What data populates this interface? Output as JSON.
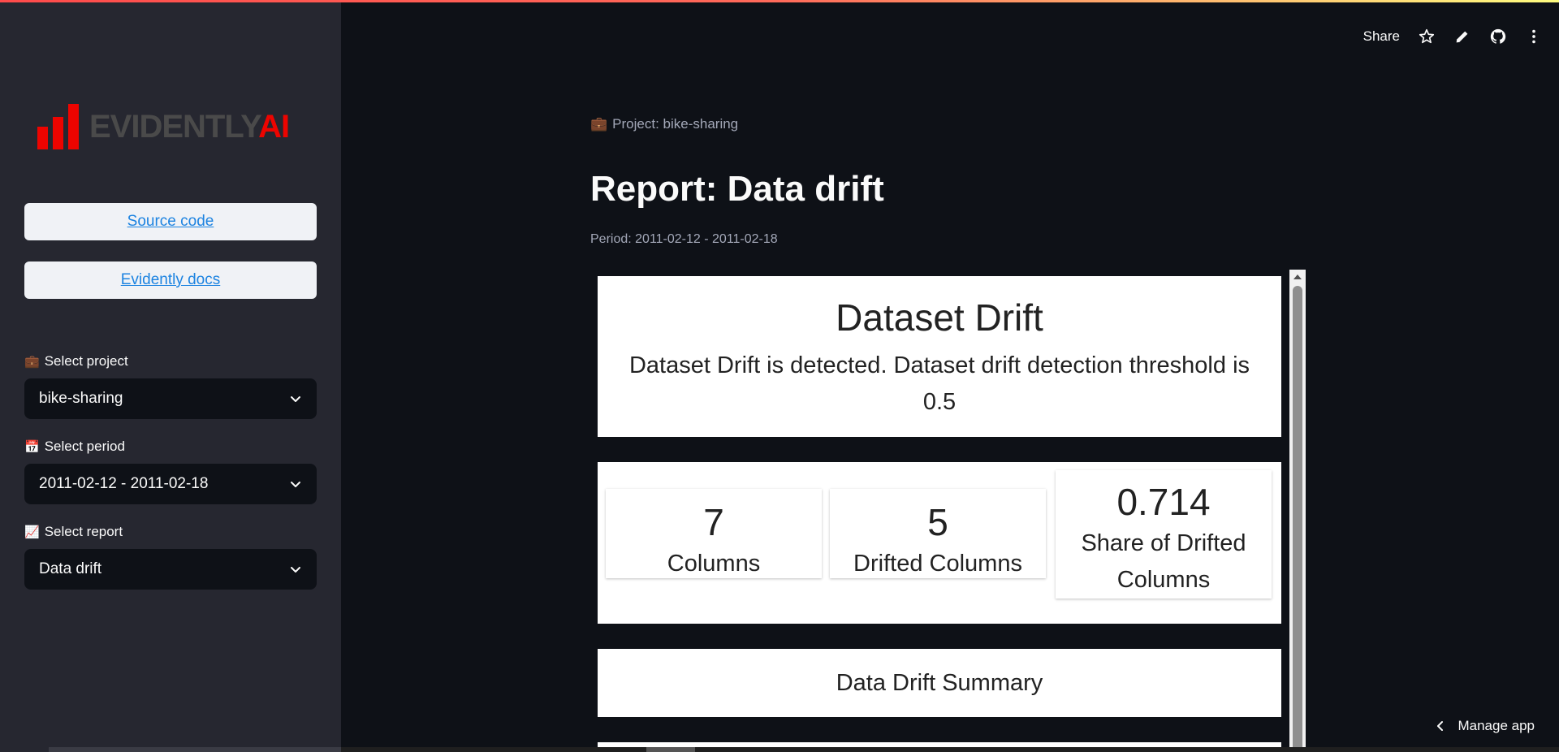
{
  "header": {
    "share_label": "Share",
    "icons": [
      "star-icon",
      "pencil-icon",
      "github-icon",
      "more-vertical-icon"
    ]
  },
  "sidebar": {
    "logo": {
      "word": "EVIDENTLY",
      "accent": "AI",
      "brand_color": "#ed0400"
    },
    "links": [
      {
        "label": "Source code"
      },
      {
        "label": "Evidently docs"
      }
    ],
    "selects": [
      {
        "emoji": "💼",
        "label": "Select project",
        "value": "bike-sharing"
      },
      {
        "emoji": "📅",
        "label": "Select period",
        "value": "2011-02-12 - 2011-02-18"
      },
      {
        "emoji": "📈",
        "label": "Select report",
        "value": "Data drift"
      }
    ]
  },
  "main": {
    "project_caption": "Project: bike-sharing",
    "project_emoji": "💼",
    "title": "Report: Data drift",
    "period_caption": "Period: 2011-02-12 - 2011-02-18"
  },
  "report": {
    "drift_title": "Dataset Drift",
    "drift_text": "Dataset Drift is detected. Dataset drift detection threshold is 0.5",
    "metrics": [
      {
        "value": "7",
        "label": "Columns"
      },
      {
        "value": "5",
        "label": "Drifted Columns"
      },
      {
        "value": "0.714",
        "label": "Share of Drifted Columns"
      }
    ],
    "summary_title": "Data Drift Summary"
  },
  "footer": {
    "manage_app_label": "Manage app"
  },
  "colors": {
    "accent": "#ff4b4b",
    "link": "#1c83e1",
    "sidebar_bg": "#262730",
    "main_bg": "#0e1117"
  }
}
